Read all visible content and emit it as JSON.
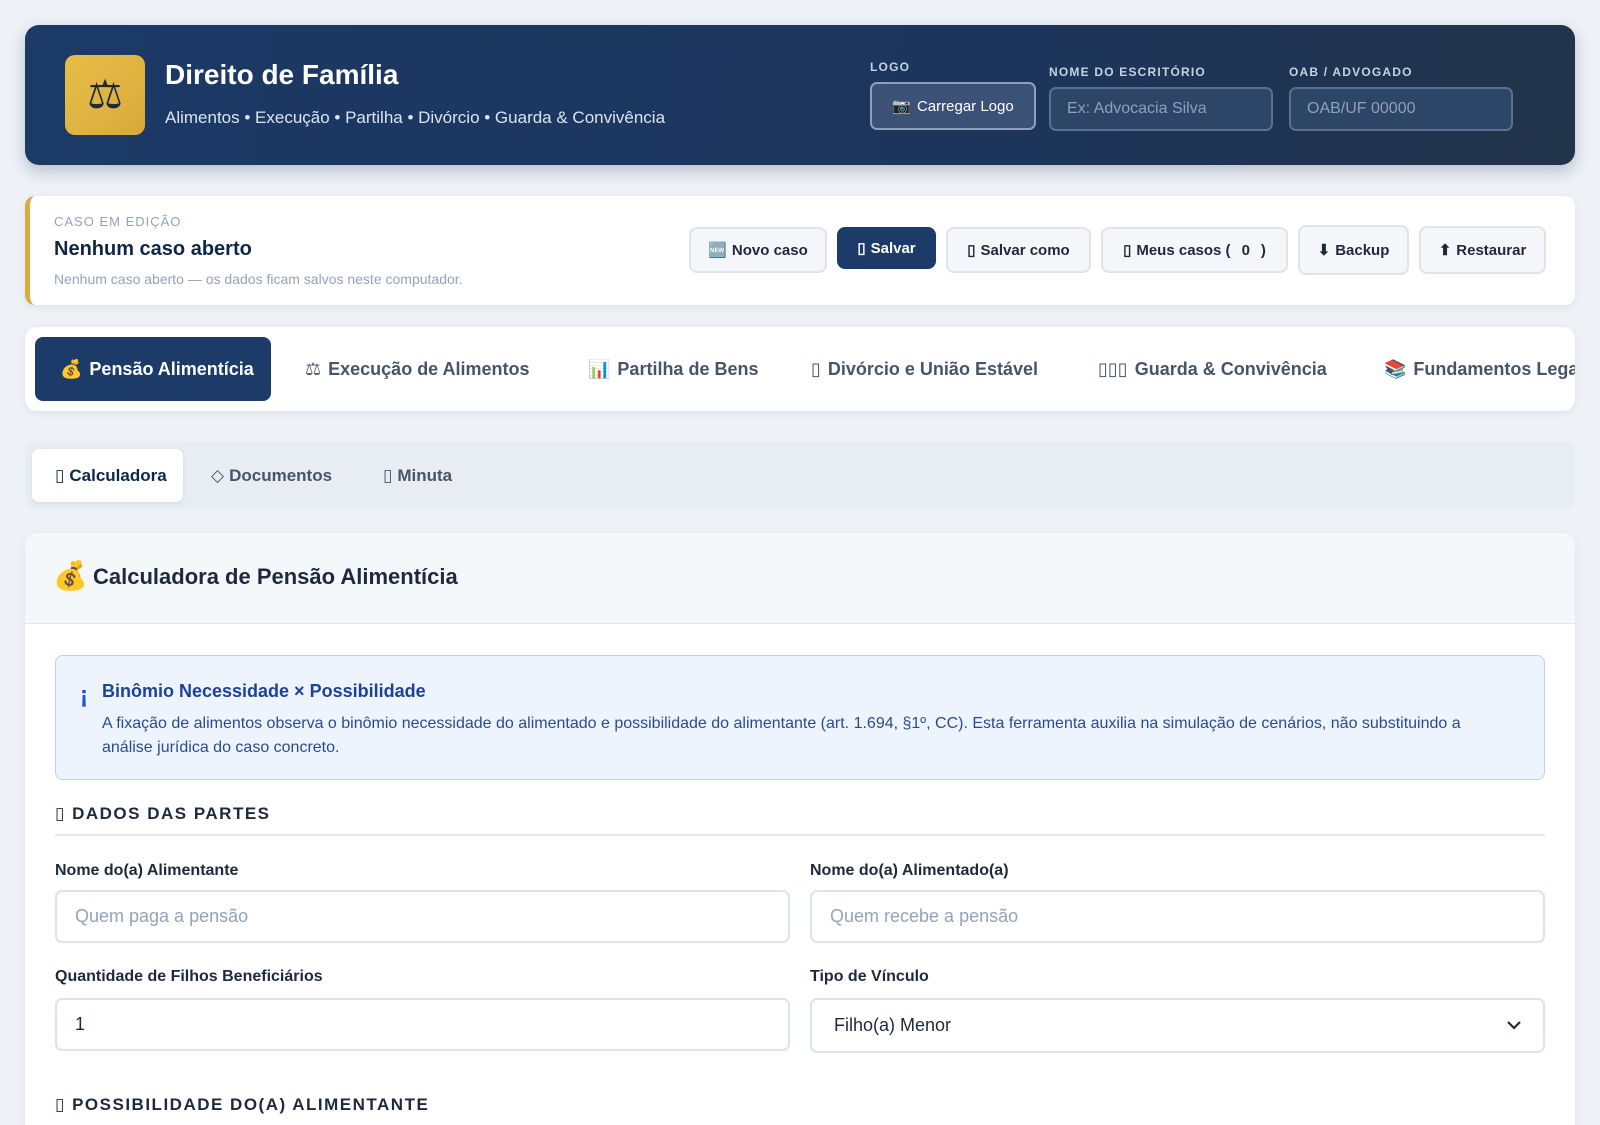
{
  "header": {
    "logo_glyph": "⚖",
    "title": "Direito de Família",
    "subtitle": "Alimentos • Execução • Partilha • Divórcio • Guarda & Convivência",
    "logo_label": "LOGO",
    "logo_button": "Carregar Logo",
    "logo_button_icon": "📷",
    "office_label": "NOME DO ESCRITÓRIO",
    "office_placeholder": "Ex: Advocacia Silva",
    "oab_label": "OAB / ADVOGADO",
    "oab_placeholder": "OAB/UF 00000"
  },
  "case": {
    "kicker": "CASO EM EDIÇÃO",
    "title": "Nenhum caso aberto",
    "subtitle": "Nenhum caso aberto — os dados ficam salvos neste computador.",
    "buttons": [
      {
        "icon": "🆕",
        "label": "Novo caso"
      },
      {
        "icon": "▯",
        "label": "Salvar"
      },
      {
        "icon": "▯",
        "label": "Salvar como"
      },
      {
        "icon": "▯",
        "label": "Meus casos (",
        "count": "0",
        "close": ")"
      },
      {
        "icon": "⬇",
        "label": "Backup"
      },
      {
        "icon": "⬆",
        "label": "Restaurar"
      }
    ]
  },
  "tabs": [
    {
      "icon": "💰",
      "label": "Pensão Alimentícia"
    },
    {
      "icon": "⚖",
      "label": "Execução de Alimentos"
    },
    {
      "icon": "📊",
      "label": "Partilha de Bens"
    },
    {
      "icon": "▯",
      "label": "Divórcio e União Estável"
    },
    {
      "icon": "▯▯▯",
      "label": "Guarda & Convivência"
    },
    {
      "icon": "📚",
      "label": "Fundamentos Legais"
    }
  ],
  "subtabs": [
    {
      "icon": "▯",
      "label": "Calculadora"
    },
    {
      "icon": "◇",
      "label": "Documentos"
    },
    {
      "icon": "▯",
      "label": "Minuta"
    }
  ],
  "panel": {
    "icon": "💰",
    "title": "Calculadora de Pensão Alimentícia",
    "info_icon": "¡",
    "info_title": "Binômio Necessidade × Possibilidade",
    "info_text": "A fixação de alimentos observa o binômio necessidade do alimentado e possibilidade do alimentante (art. 1.694, §1º, CC). Esta ferramenta auxilia na simulação de cenários, não substituindo a análise jurídica do caso concreto.",
    "section1_icon": "▯",
    "section1": "DADOS DAS PARTES",
    "alimentante_label": "Nome do(a) Alimentante",
    "alimentante_placeholder": "Quem paga a pensão",
    "alimentado_label": "Nome do(a) Alimentado(a)",
    "alimentado_placeholder": "Quem recebe a pensão",
    "filhos_label": "Quantidade de Filhos Beneficiários",
    "filhos_value": "1",
    "vinculo_label": "Tipo de Vínculo",
    "vinculo_value": "Filho(a) Menor",
    "section2_icon": "▯",
    "section2": "POSSIBILIDADE DO(A) ALIMENTANTE"
  }
}
